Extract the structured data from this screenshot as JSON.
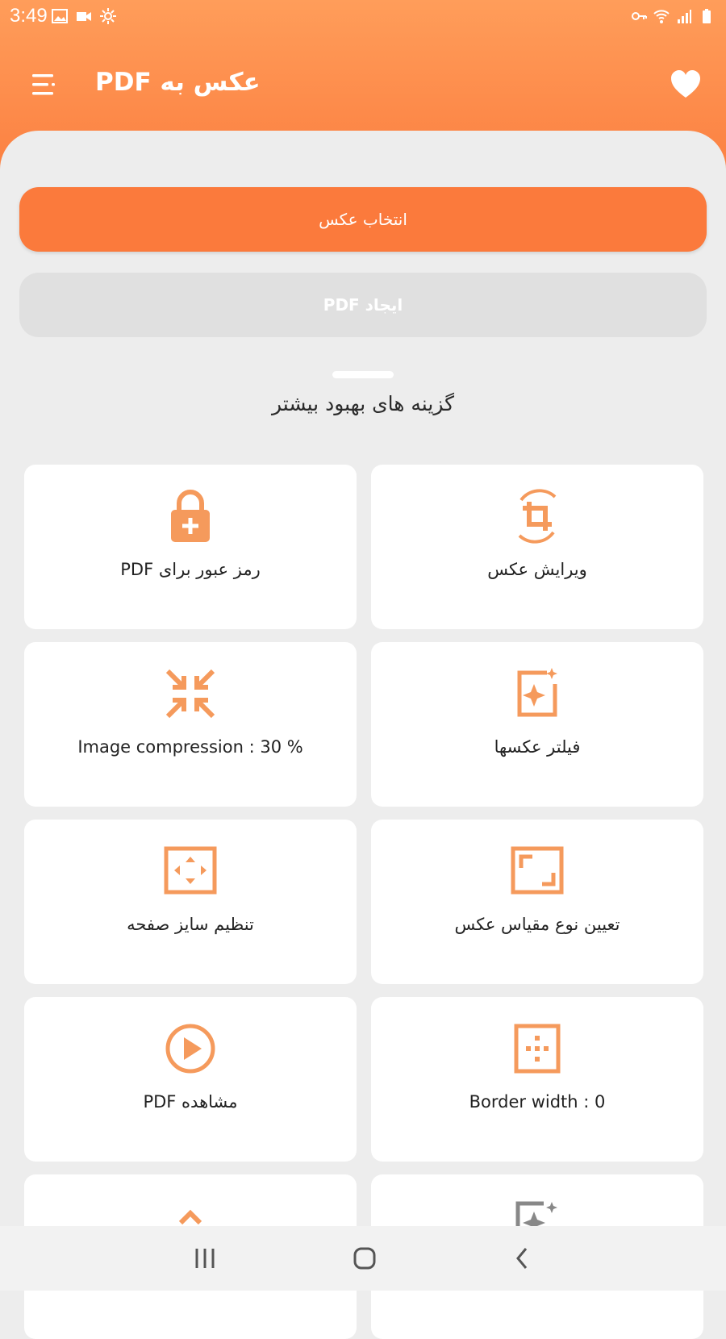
{
  "status_bar": {
    "time": "3:49",
    "left_icons": [
      "gallery-icon",
      "video-icon",
      "settings-sun-icon"
    ],
    "right_icons": [
      "vpn-key-icon",
      "wifi-icon",
      "signal-icon",
      "battery-icon"
    ]
  },
  "app_bar": {
    "title": "عکس به PDF",
    "menu_icon": "menu-icon",
    "favorite_icon": "heart-icon"
  },
  "actions": {
    "select_photo": "انتخاب عکس",
    "create_pdf": "ایجاد PDF"
  },
  "section": {
    "title": "گزینه های بهبود بیشتر"
  },
  "options": [
    {
      "label": "رمز عبور برای PDF",
      "icon": "lock-plus-icon"
    },
    {
      "label": "ویرایش عکس",
      "icon": "crop-rotate-icon"
    },
    {
      "label": "Image compression : 30 %",
      "icon": "compress-arrows-icon"
    },
    {
      "label": "فیلتر عکسها",
      "icon": "image-sparkle-icon"
    },
    {
      "label": "تنظیم سایز صفحه",
      "icon": "page-size-icon"
    },
    {
      "label": "تعیین نوع مقیاس عکس",
      "icon": "aspect-ratio-icon"
    },
    {
      "label": "مشاهده PDF",
      "icon": "play-circle-icon"
    },
    {
      "label": "Border width : 0",
      "icon": "border-grid-icon"
    },
    {
      "label": "",
      "icon": "chevron-up-icon"
    },
    {
      "label": "",
      "icon": "image-enhance-icon"
    }
  ],
  "colors": {
    "accent": "#fb7a3c",
    "icon": "#f59a5c",
    "header_top": "#ff9d5a"
  },
  "nav_bar": {
    "recents": "recents-icon",
    "home": "home-icon",
    "back": "back-icon"
  }
}
